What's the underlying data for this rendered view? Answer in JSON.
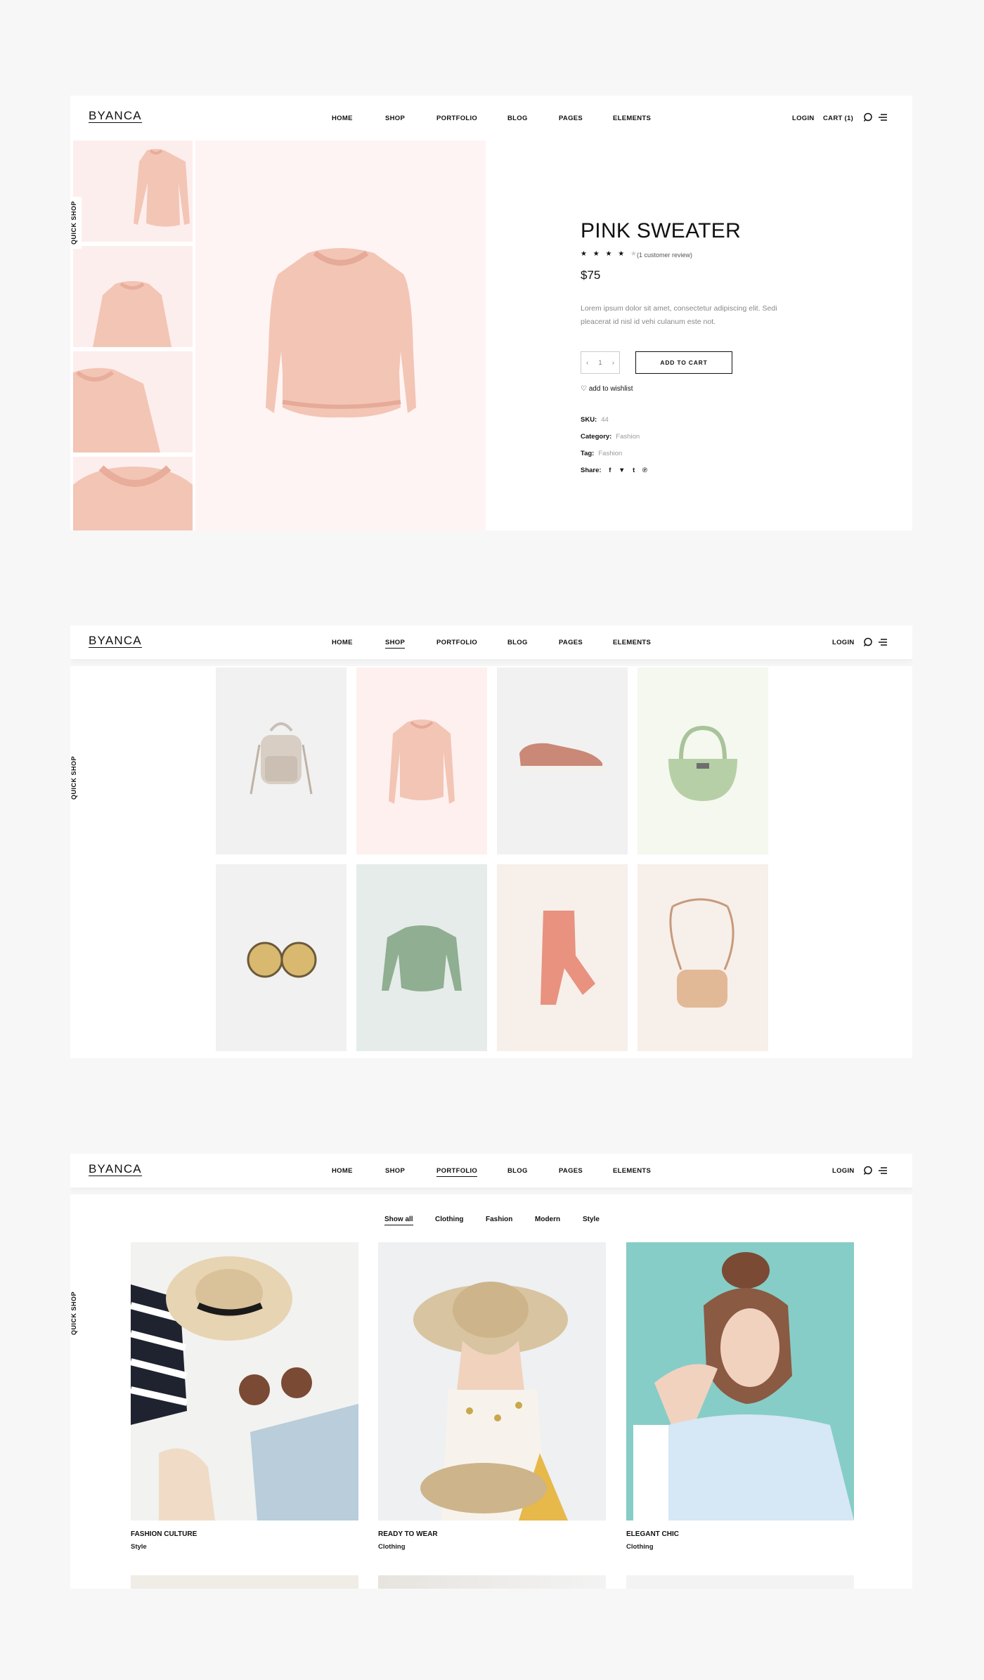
{
  "brand": "BYANCA",
  "nav": [
    "HOME",
    "SHOP",
    "PORTFOLIO",
    "BLOG",
    "PAGES",
    "ELEMENTS"
  ],
  "quick_shop": "QUICK SHOP",
  "product_page": {
    "login": "LOGIN",
    "cart": "CART (1)",
    "title": "PINK SWEATER",
    "rating_stars": 4,
    "stars_text": "★ ★ ★ ★ ★",
    "review": "(1 customer review)",
    "price": "$75",
    "description": "Lorem ipsum dolor sit amet, consectetur adipiscing elit. Sedi pleacerat id nisl id vehi culanum este not.",
    "quantity": "1",
    "add_to_cart": "ADD TO CART",
    "wishlist": "add to wishlist",
    "sku_label": "SKU:",
    "sku": "44",
    "category_label": "Category:",
    "category": "Fashion",
    "tag_label": "Tag:",
    "tag": "Fashion",
    "share_label": "Share:",
    "colors": {
      "pink_bg": "#fff4f4",
      "sweater": "#f3c4b4"
    }
  },
  "shop_page": {
    "login": "LOGIN",
    "active_menu": "SHOP",
    "products": [
      "backpack",
      "pink-sweater",
      "sneaker",
      "green-handbag",
      "earrings",
      "green-sweater",
      "pink-pants",
      "crossbody-bag"
    ]
  },
  "portfolio_page": {
    "login": "LOGIN",
    "active_menu": "PORTFOLIO",
    "filters": [
      "Show all",
      "Clothing",
      "Fashion",
      "Modern",
      "Style"
    ],
    "items": [
      {
        "title": "FASHION CULTURE",
        "category": "Style"
      },
      {
        "title": "READY TO WEAR",
        "category": "Clothing"
      },
      {
        "title": "ELEGANT CHIC",
        "category": "Clothing"
      }
    ]
  }
}
